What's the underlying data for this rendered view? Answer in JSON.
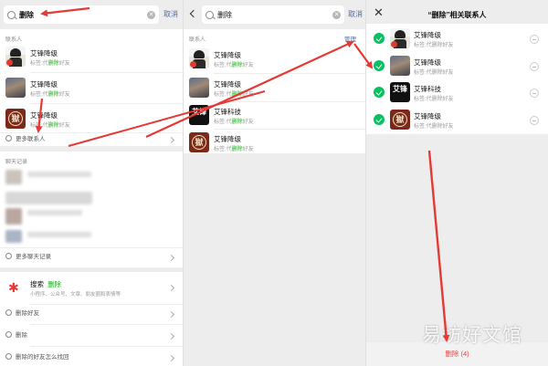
{
  "panel1": {
    "search_query": "删除",
    "cancel_label": "取消",
    "contacts_section_title": "联系人",
    "contacts": [
      {
        "name": "艾锋降级",
        "tag_prefix": "标签:代",
        "tag_highlight": "删除",
        "tag_suffix": "好友",
        "avatar": "cartoon"
      },
      {
        "name": "艾锋降级",
        "tag_prefix": "标签:代",
        "tag_highlight": "删除",
        "tag_suffix": "好友",
        "avatar": "photo"
      },
      {
        "name": "艾锋降级",
        "tag_prefix": "标签:代",
        "tag_highlight": "删除",
        "tag_suffix": "好友",
        "avatar": "seal"
      }
    ],
    "more_contacts_label": "更多联系人",
    "chat_section_title": "聊天记录",
    "more_chats_label": "更多聊天记录",
    "search_entry_title": "搜索",
    "search_entry_keyword": "删除",
    "search_entry_subtitle": "小程序、公众号、文章、朋友圈和表情等",
    "suggestions": [
      "删除好友",
      "删除",
      "删除的好友怎么找回"
    ]
  },
  "panel2": {
    "search_query": "删除",
    "cancel_label": "取消",
    "contacts_section_title": "联系人",
    "manage_label": "管理",
    "contacts": [
      {
        "name": "艾锋降级",
        "tag_prefix": "标签:代",
        "tag_highlight": "删除",
        "tag_suffix": "好友",
        "avatar": "cartoon"
      },
      {
        "name": "艾锋降级",
        "tag_prefix": "标签:代",
        "tag_highlight": "删除",
        "tag_suffix": "好友",
        "avatar": "photo"
      },
      {
        "name": "艾锋科技",
        "tag_prefix": "标签:代",
        "tag_highlight": "删除",
        "tag_suffix": "好友",
        "avatar": "text",
        "avatar_text": "艾锋"
      },
      {
        "name": "艾锋降级",
        "tag_prefix": "标签:代",
        "tag_highlight": "删除",
        "tag_suffix": "好友",
        "avatar": "seal"
      }
    ]
  },
  "panel3": {
    "title": "“删除”相关联系人",
    "contacts": [
      {
        "name": "艾锋降级",
        "tag": "标签:代删除好友",
        "avatar": "cartoon"
      },
      {
        "name": "艾锋降级",
        "tag": "标签:代删除好友",
        "avatar": "photo"
      },
      {
        "name": "艾锋科技",
        "tag": "标签:代删除好友",
        "avatar": "text",
        "avatar_text": "艾锋"
      },
      {
        "name": "艾锋降级",
        "tag": "标签:代删除好友",
        "avatar": "seal"
      }
    ],
    "delete_button_label": "删除 (4)",
    "watermark": "易坊好文馆"
  },
  "colors": {
    "accent_green": "#07c160",
    "highlight_green": "#1aad19",
    "link_blue": "#576b95",
    "delete_red": "#e64340",
    "annotation_arrow": "#e53935"
  },
  "icons": {
    "search": "magnifier-icon",
    "clear": "clear-x-icon",
    "back": "chevron-left-icon",
    "close": "close-x-icon",
    "check": "check-circle-icon",
    "deselect": "minus-circle-icon",
    "mini_program": "search-star-icon"
  }
}
